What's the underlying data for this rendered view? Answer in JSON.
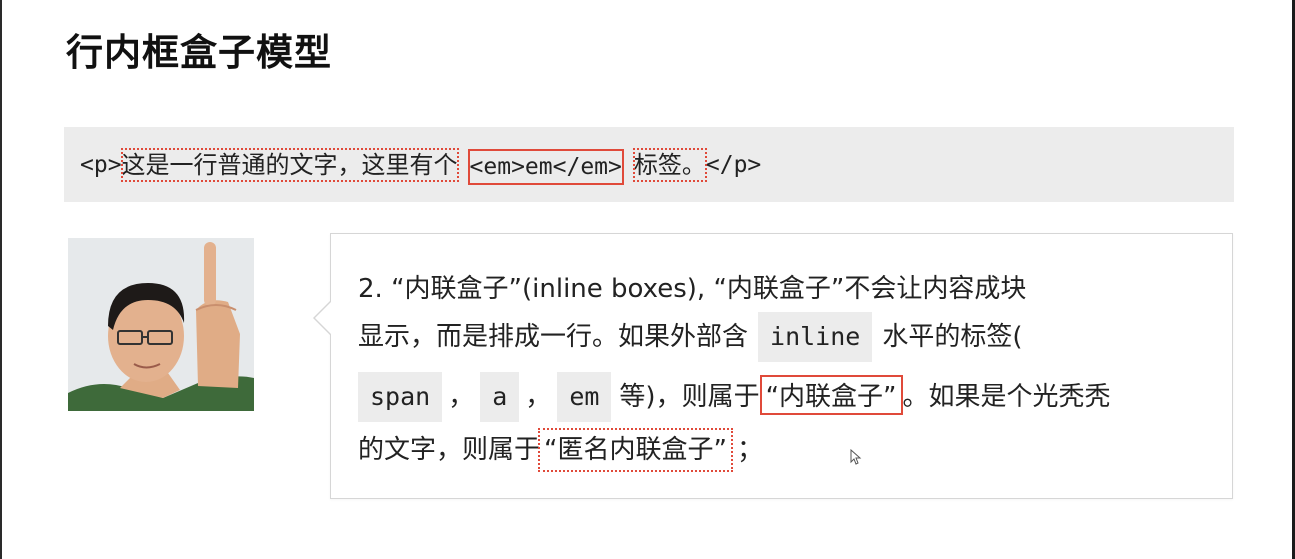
{
  "slide": {
    "title": "行内框盒子模型"
  },
  "code_example": {
    "open_tag": "<p>",
    "text_before": "这是一行普通的文字，这里有个",
    "em_element": "<em>em</em>",
    "text_after": "标签。",
    "close_tag": "</p>"
  },
  "explanation": {
    "line1": "2. “内联盒子”(inline boxes), “内联盒子”不会让内容成块",
    "line2_text": "显示，而是排成一行。如果外部含",
    "line2_code": "inline",
    "line2_after": "水平的标签(",
    "line3_code1": "span",
    "line3_sep1": "，",
    "line3_code2": "a",
    "line3_sep2": "，",
    "line3_code3": "em",
    "line3_text": "等)，则属于",
    "line3_boxed": "“内联盒子”",
    "line3_after": "。如果是个光秃秃",
    "line4_text": "的文字，则属于",
    "line4_boxed": "“匿名内联盒子”",
    "line4_after": "；"
  },
  "colors": {
    "accent_red": "#e04a3a",
    "code_bg": "#ececec"
  },
  "icons": {
    "presenter": "presenter-photo",
    "cursor": "mouse-pointer-icon"
  }
}
